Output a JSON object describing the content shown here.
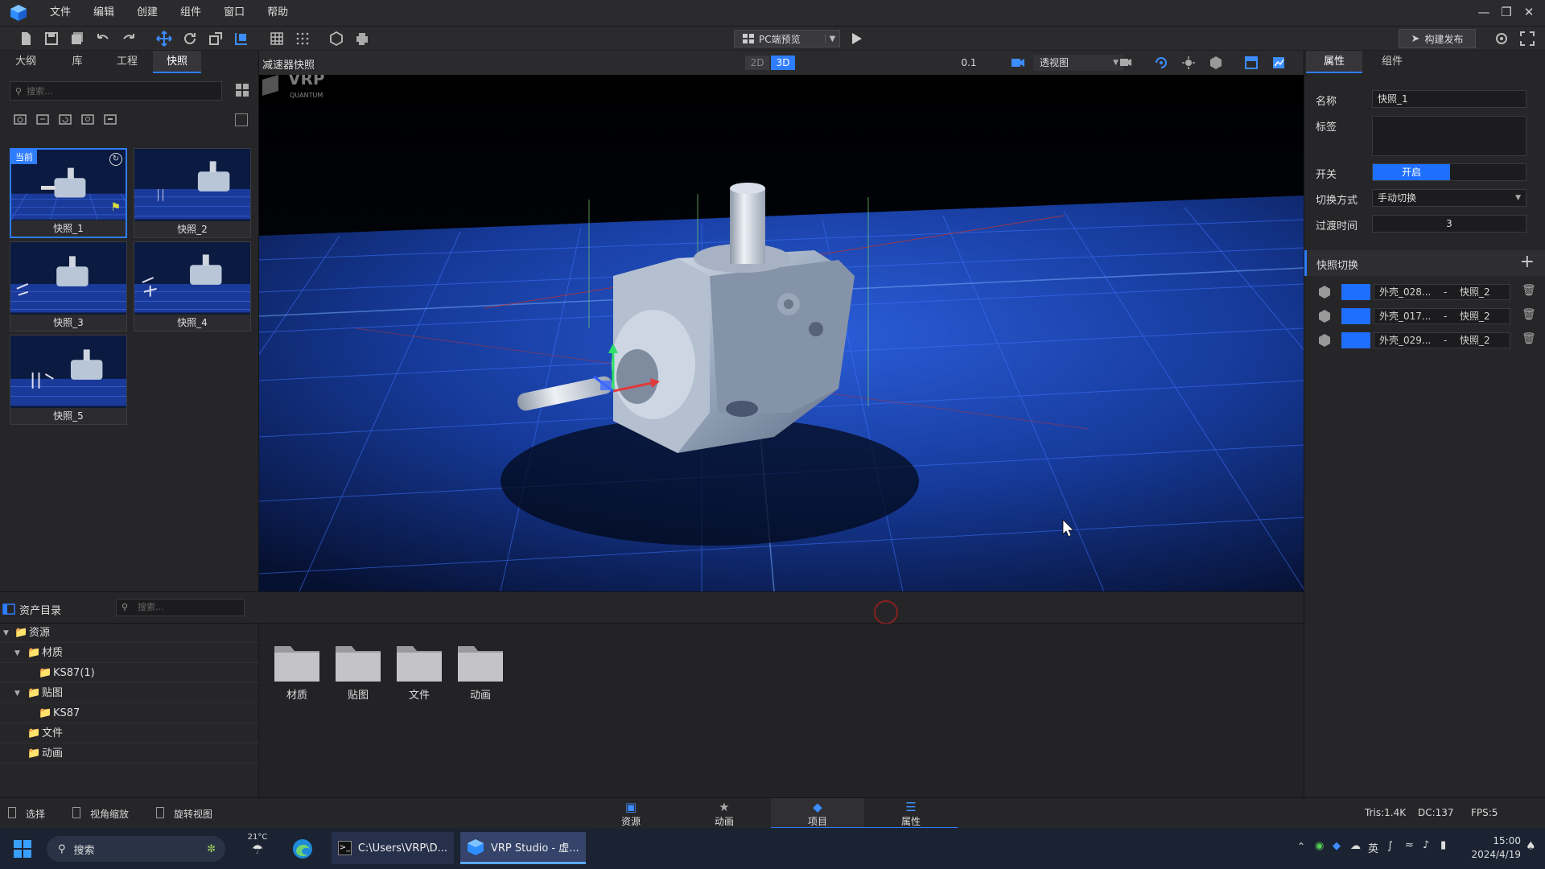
{
  "menu": {
    "items": [
      "文件",
      "编辑",
      "创建",
      "组件",
      "窗口",
      "帮助"
    ]
  },
  "toolbar": {
    "preview_mode": "PC端预览",
    "publish_label": "构建发布"
  },
  "left_panel": {
    "tabs": [
      "大纲",
      "库",
      "工程",
      "快照"
    ],
    "active_tab": "快照",
    "search_placeholder": "搜索...",
    "current_badge": "当前",
    "snapshots": [
      {
        "label": "快照_1"
      },
      {
        "label": "快照_2"
      },
      {
        "label": "快照_3"
      },
      {
        "label": "快照_4"
      },
      {
        "label": "快照_5"
      }
    ]
  },
  "viewport": {
    "title": "减速器快照",
    "mode_2d": "2D",
    "mode_3d": "3D",
    "speed_value": "0.1",
    "view_mode": "透视图",
    "watermark": "VRP",
    "watermark_sub": "QUANTUM"
  },
  "right_panel": {
    "tabs": [
      "属性",
      "组件"
    ],
    "active_tab": "属性",
    "name_label": "名称",
    "name_value": "快照_1",
    "tag_label": "标签",
    "switch_label": "开关",
    "switch_value": "开启",
    "switch_mode_label": "切换方式",
    "switch_mode_value": "手动切换",
    "transition_label": "过渡时间",
    "transition_value": "3",
    "section_title": "快照切换",
    "rows": [
      {
        "object": "外壳_028...",
        "sep": "-",
        "target": "快照_2"
      },
      {
        "object": "外壳_017...",
        "sep": "-",
        "target": "快照_2"
      },
      {
        "object": "外壳_029...",
        "sep": "-",
        "target": "快照_2"
      }
    ],
    "accent_color": "#1f6fff"
  },
  "assets": {
    "header": "资产目录",
    "search_placeholder": "搜索...",
    "tree": [
      {
        "label": "资源",
        "level": 0,
        "expanded": true
      },
      {
        "label": "材质",
        "level": 1,
        "expanded": true
      },
      {
        "label": "KS87(1)",
        "level": 2
      },
      {
        "label": "贴图",
        "level": 1,
        "expanded": true
      },
      {
        "label": "KS87",
        "level": 2
      },
      {
        "label": "文件",
        "level": 1
      },
      {
        "label": "动画",
        "level": 1
      }
    ],
    "folders": [
      "材质",
      "贴图",
      "文件",
      "动画"
    ]
  },
  "statusbar": {
    "left_tools": [
      "选择",
      "视角缩放",
      "旋转视图"
    ],
    "tabs": [
      "资源",
      "动画",
      "项目",
      "属性"
    ],
    "active_tab": "项目",
    "tris": "Tris:1.4K",
    "dc": "DC:137",
    "fps": "FPS:5"
  },
  "taskbar": {
    "search_label": "搜索",
    "weather": "21°C",
    "terminal_label": "C:\\Users\\VRP\\D...",
    "vrp_label": "VRP Studio - 虚...",
    "ime": "英",
    "time": "15:00",
    "date": "2024/4/19"
  }
}
